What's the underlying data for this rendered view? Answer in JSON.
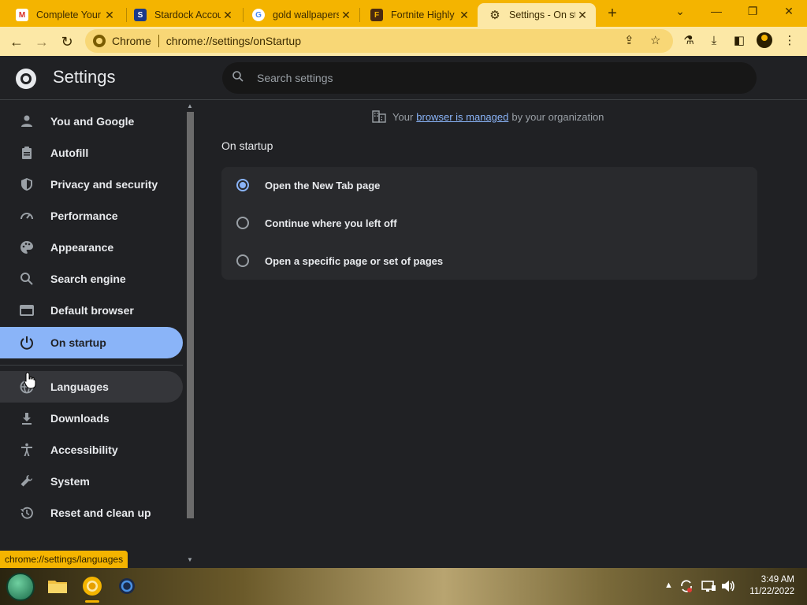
{
  "tabs": [
    {
      "title": "Complete Your",
      "icon": "gmail-icon"
    },
    {
      "title": "Stardock Accou",
      "icon": "stardock-icon"
    },
    {
      "title": "gold wallpapers",
      "icon": "google-icon"
    },
    {
      "title": "Fortnite Highly",
      "icon": "fortnite-icon"
    },
    {
      "title": "Settings - On st",
      "icon": "gear-icon"
    }
  ],
  "omnibox": {
    "site": "Chrome",
    "url": "chrome://settings/onStartup"
  },
  "header": {
    "title": "Settings",
    "search_placeholder": "Search settings"
  },
  "sidebar": {
    "items": [
      {
        "label": "You and Google",
        "icon": "person-icon"
      },
      {
        "label": "Autofill",
        "icon": "clipboard-icon"
      },
      {
        "label": "Privacy and security",
        "icon": "shield-icon"
      },
      {
        "label": "Performance",
        "icon": "gauge-icon"
      },
      {
        "label": "Appearance",
        "icon": "palette-icon"
      },
      {
        "label": "Search engine",
        "icon": "search-icon"
      },
      {
        "label": "Default browser",
        "icon": "browser-icon"
      },
      {
        "label": "On startup",
        "icon": "power-icon"
      },
      {
        "label": "Languages",
        "icon": "globe-icon"
      },
      {
        "label": "Downloads",
        "icon": "download-icon"
      },
      {
        "label": "Accessibility",
        "icon": "accessibility-icon"
      },
      {
        "label": "System",
        "icon": "wrench-icon"
      },
      {
        "label": "Reset and clean up",
        "icon": "history-icon"
      }
    ],
    "active": "On startup"
  },
  "main": {
    "managed_prefix": "Your",
    "managed_link": "browser is managed",
    "managed_suffix": "by your organization",
    "section_title": "On startup",
    "options": [
      {
        "label": "Open the New Tab page",
        "checked": true
      },
      {
        "label": "Continue where you left off",
        "checked": false
      },
      {
        "label": "Open a specific page or set of pages",
        "checked": false
      }
    ]
  },
  "status_url": "chrome://settings/languages",
  "clock": {
    "time": "3:49 AM",
    "date": "11/22/2022"
  },
  "colors": {
    "accent": "#8ab4f8",
    "frame": "#f4b400",
    "toolbar": "#fce8a6",
    "bg": "#202124"
  }
}
